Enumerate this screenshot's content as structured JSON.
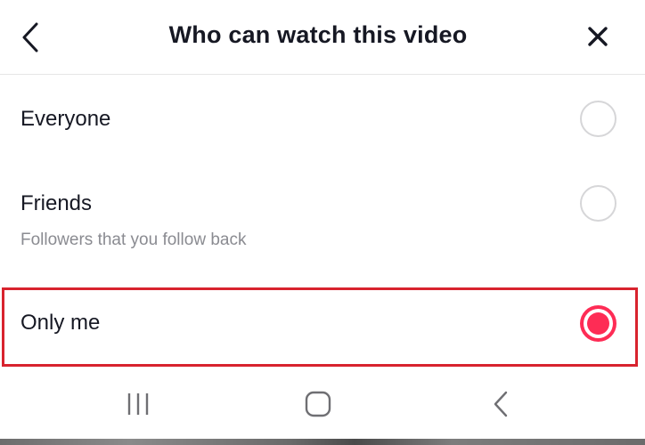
{
  "header": {
    "title": "Who can watch this video",
    "back_icon": "chevron-left-icon",
    "close_icon": "close-icon"
  },
  "options": [
    {
      "label": "Everyone",
      "sublabel": "",
      "selected": false
    },
    {
      "label": "Friends",
      "sublabel": "Followers that you follow back",
      "selected": false
    },
    {
      "label": "Only me",
      "sublabel": "",
      "selected": true
    }
  ],
  "navbar": {
    "recents_icon": "recent-apps-icon",
    "home_icon": "home-icon",
    "back_icon": "back-chevron-icon"
  },
  "colors": {
    "accent": "#fe2c55",
    "highlight_border": "#d8232e",
    "text_primary": "#161823",
    "text_secondary": "#8a8b91"
  }
}
